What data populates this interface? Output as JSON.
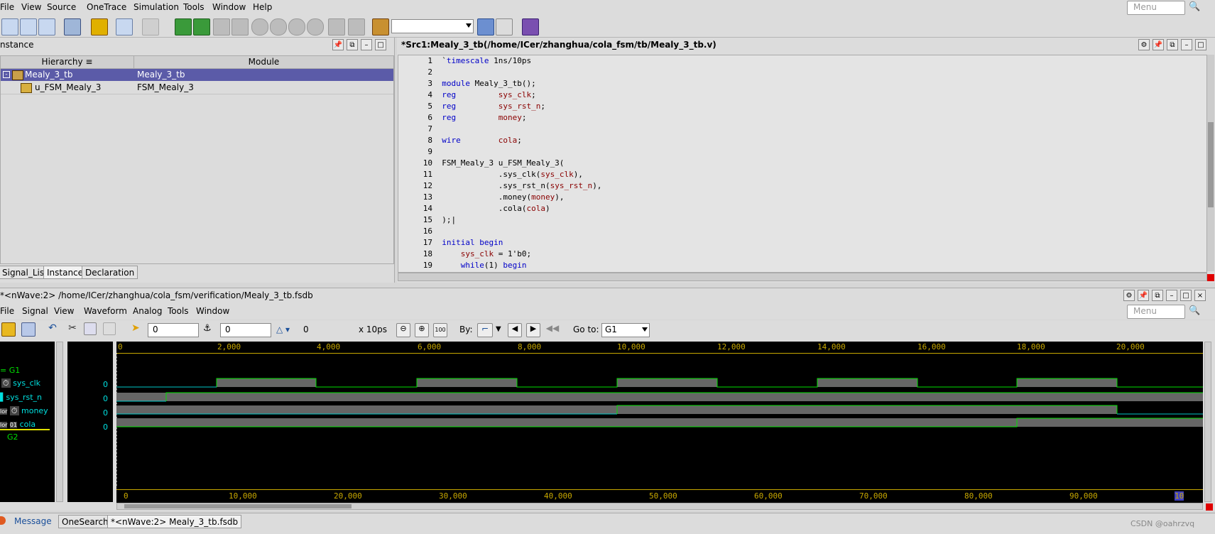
{
  "main_menu": [
    "File",
    "View",
    "Source",
    "OneTrace",
    "Simulation",
    "Tools",
    "Window",
    "Help"
  ],
  "menu_search_placeholder": "Menu",
  "hierarchy_panel": {
    "title": "nstance",
    "col_hierarchy": "Hierarchy",
    "col_module": "Module",
    "rows": [
      {
        "name": "Mealy_3_tb",
        "module": "Mealy_3_tb"
      },
      {
        "name": "u_FSM_Mealy_3",
        "module": "FSM_Mealy_3"
      }
    ],
    "tabs": [
      "Signal_List",
      "Instance",
      "Declaration"
    ]
  },
  "source_panel": {
    "title": "*Src1:Mealy_3_tb(/home/ICer/zhanghua/cola_fsm/tb/Mealy_3_tb.v)",
    "line_numbers": [
      "1",
      "2",
      "3",
      "4",
      "5",
      "6",
      "7",
      "8",
      "9",
      "10",
      "11",
      "12",
      "13",
      "14",
      "15",
      "16",
      "17",
      "18",
      "19"
    ]
  },
  "nwave": {
    "title": "*<nWave:2> /home/ICer/zhanghua/cola_fsm/verification/Mealy_3_tb.fsdb",
    "menu": [
      "File",
      "Signal",
      "View",
      "Waveform",
      "Analog",
      "Tools",
      "Window"
    ],
    "cursor_value": "0",
    "marker_value": "0",
    "delta_value": "0",
    "time_unit": "x 10ps",
    "by_label": "By:",
    "goto_label": "Go to:",
    "goto_value": "G1",
    "groups": [
      "G1",
      "G2"
    ],
    "signals": [
      {
        "name": "sys_clk",
        "value": "0"
      },
      {
        "name": "sys_rst_n",
        "value": "0"
      },
      {
        "name": "money",
        "value": "0"
      },
      {
        "name": "cola",
        "value": "0"
      }
    ],
    "top_ruler": [
      "0",
      "2,000",
      "4,000",
      "6,000",
      "8,000",
      "10,000",
      "12,000",
      "14,000",
      "16,000",
      "18,000",
      "20,000"
    ],
    "bottom_ruler": [
      "0",
      "10,000",
      "20,000",
      "30,000",
      "40,000",
      "50,000",
      "60,000",
      "70,000",
      "80,000",
      "90,000",
      "10"
    ]
  },
  "bottom_tabs": [
    "Message",
    "OneSearch",
    "*<nWave:2> Mealy_3_tb.fsdb"
  ],
  "watermark": "CSDN @oahrzvq",
  "colors": {
    "selected_row": "#5b5ba8",
    "wave_green": "#00e000",
    "wave_cyan": "#00c8c8",
    "ruler_yellow": "#c8a800"
  }
}
